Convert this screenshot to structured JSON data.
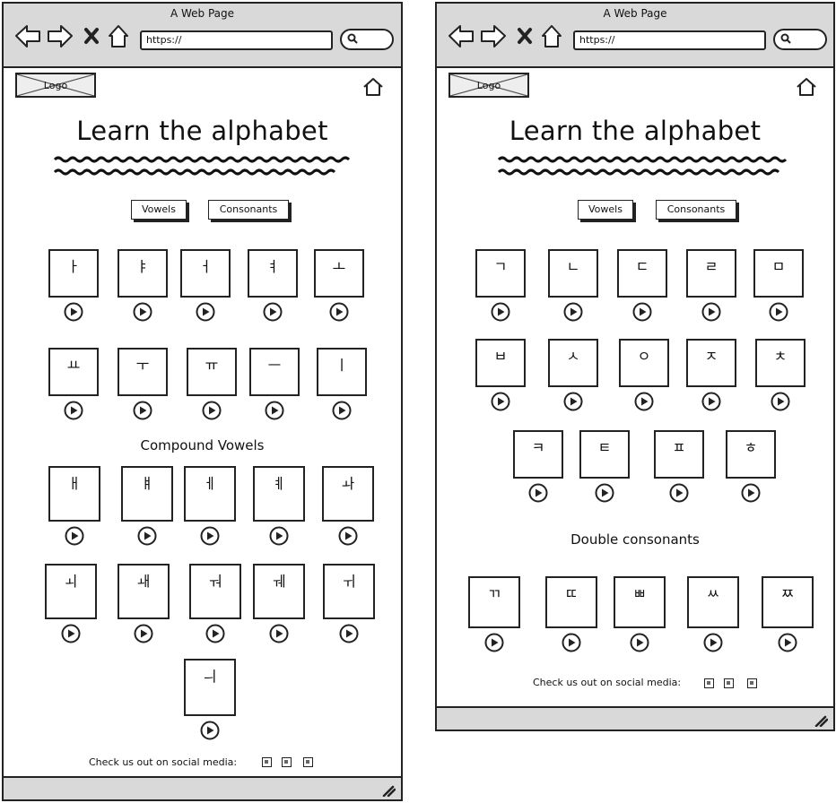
{
  "browser": {
    "title": "A Web Page",
    "url": "https://"
  },
  "logo": {
    "label": "Logo"
  },
  "page": {
    "heading": "Learn the alphabet",
    "vowels_button": "Vowels",
    "consonants_button": "Consonants",
    "social_text": "Check us out on social media:"
  },
  "vowels_view": {
    "vowels": [
      "ㅏ",
      "ㅑ",
      "ㅓ",
      "ㅕ",
      "ㅗ",
      "ㅛ",
      "ㅜ",
      "ㅠ",
      "ㅡ",
      "ㅣ"
    ],
    "compound_title": "Compound Vowels",
    "compound_vowels": [
      "ㅐ",
      "ㅒ",
      "ㅔ",
      "ㅖ",
      "ㅘ",
      "ㅚ",
      "ㅙ",
      "ㅝ",
      "ㅞ",
      "ㅟ",
      "ㅢ"
    ]
  },
  "consonants_view": {
    "consonants": [
      "ㄱ",
      "ㄴ",
      "ㄷ",
      "ㄹ",
      "ㅁ",
      "ㅂ",
      "ㅅ",
      "ㅇ",
      "ㅈ",
      "ㅊ",
      "ㅋ",
      "ㅌ",
      "ㅍ",
      "ㅎ"
    ],
    "double_title": "Double consonants",
    "double_consonants": [
      "ㄲ",
      "ㄸ",
      "ㅃ",
      "ㅆ",
      "ㅉ"
    ]
  },
  "icons": {
    "back": "back-arrow-icon",
    "forward": "forward-arrow-icon",
    "close": "close-icon",
    "home": "home-icon",
    "search": "search-icon",
    "play": "play-icon",
    "social": "social-icon",
    "grip": "resize-grip-icon"
  }
}
